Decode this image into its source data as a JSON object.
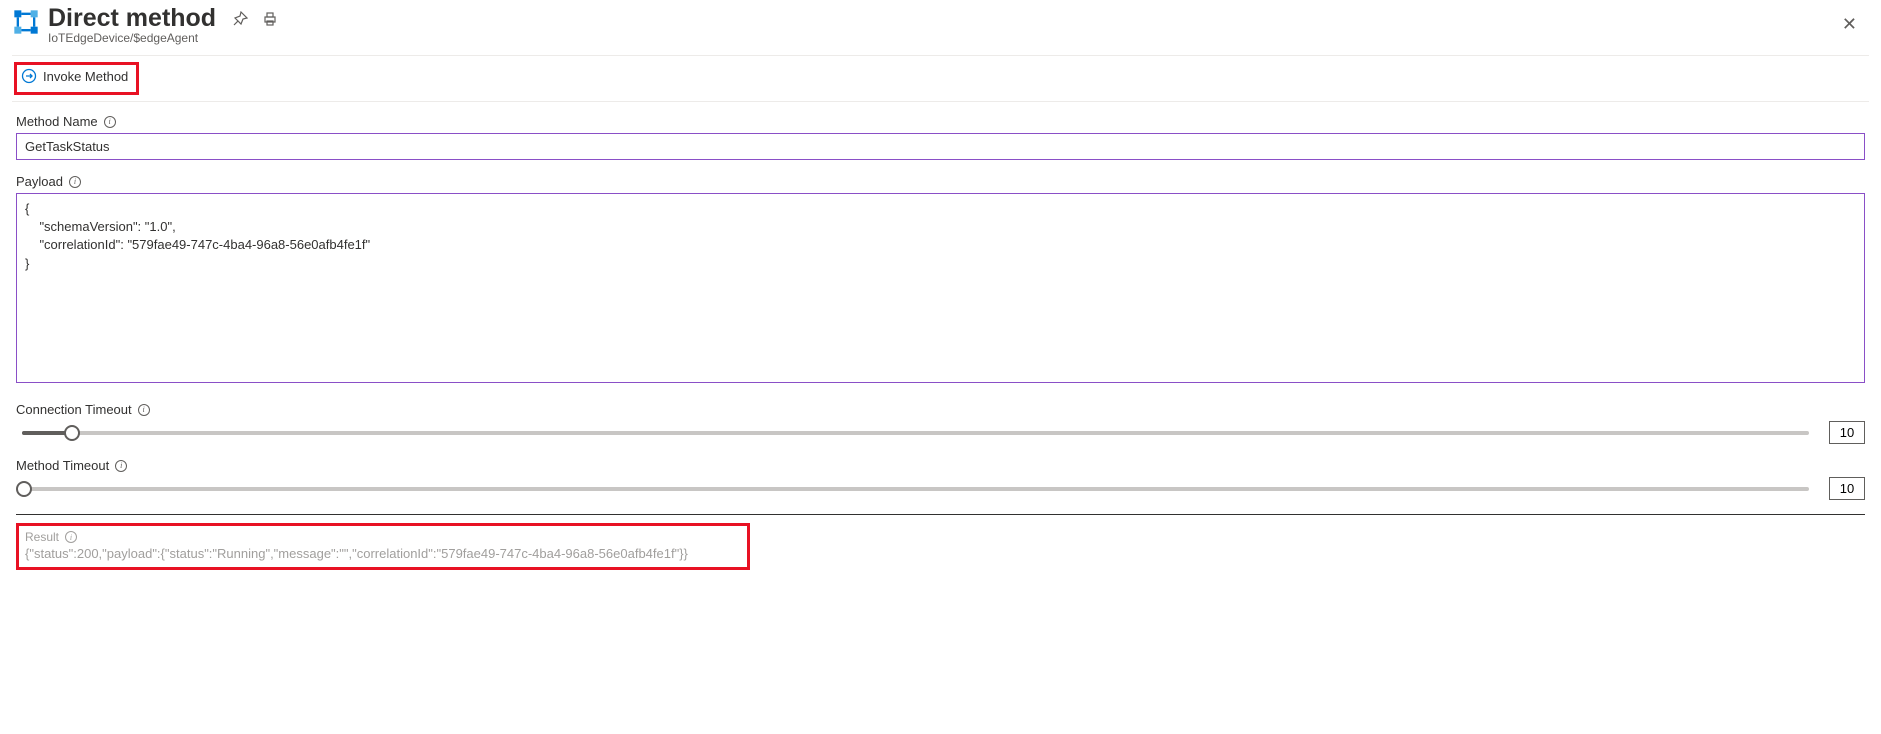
{
  "header": {
    "title": "Direct method",
    "breadcrumb": "IoTEdgeDevice/$edgeAgent"
  },
  "toolbar": {
    "invoke_label": "Invoke Method"
  },
  "fields": {
    "method_name": {
      "label": "Method Name",
      "value": "GetTaskStatus"
    },
    "payload": {
      "label": "Payload",
      "value": "{\n    \"schemaVersion\": \"1.0\",\n    \"correlationId\": \"579fae49-747c-4ba4-96a8-56e0afb4fe1f\"\n}"
    },
    "connection_timeout": {
      "label": "Connection Timeout",
      "value": "10"
    },
    "method_timeout": {
      "label": "Method Timeout",
      "value": "10"
    }
  },
  "result": {
    "label": "Result",
    "value": "{\"status\":200,\"payload\":{\"status\":\"Running\",\"message\":\"\",\"correlationId\":\"579fae49-747c-4ba4-96a8-56e0afb4fe1f\"}}"
  }
}
